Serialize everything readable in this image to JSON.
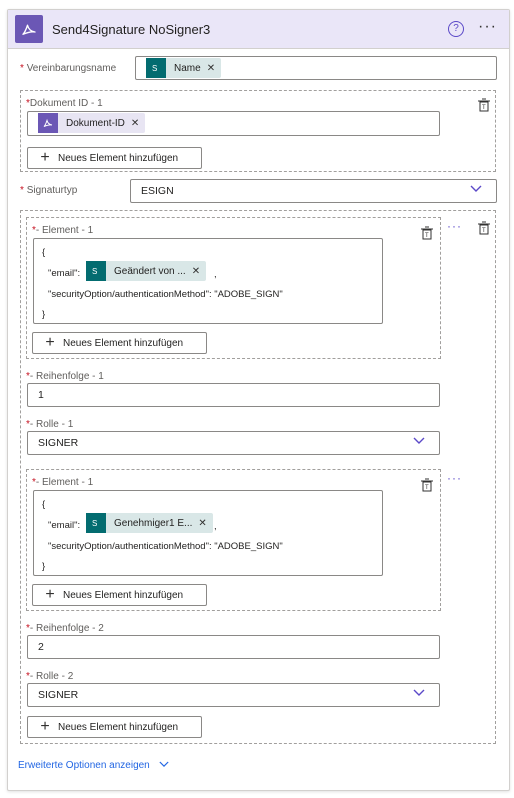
{
  "header": {
    "title": "Send4Signature NoSigner3"
  },
  "fields": {
    "vereinbarungsname": {
      "label": "Vereinbarungsname",
      "token": "Name"
    },
    "dokument": {
      "label": "Dokument ID - 1",
      "token": "Dokument-ID",
      "add_label": "Neues Element hinzufügen"
    },
    "signaturtyp": {
      "label": "Signaturtyp",
      "value": "ESIGN"
    }
  },
  "signers": [
    {
      "element_label": "- Element - 1",
      "json_open": "{",
      "email_key": "\"email\":",
      "email_token": "Geändert von ...",
      "comma": ",",
      "security_line": "\"securityOption/authenticationMethod\": \"ADOBE_SIGN\"",
      "json_close": "}",
      "add_label": "Neues Element hinzufügen",
      "order_label": "- Reihenfolge - 1",
      "order_value": "1",
      "role_label": "- Rolle - 1",
      "role_value": "SIGNER"
    },
    {
      "element_label": "- Element - 1",
      "json_open": "{",
      "email_key": "\"email\":",
      "email_token": "Genehmiger1 E...",
      "comma": ",",
      "security_line": "\"securityOption/authenticationMethod\": \"ADOBE_SIGN\"",
      "json_close": "}",
      "add_label": "Neues Element hinzufügen",
      "order_label": "- Reihenfolge - 2",
      "order_value": "2",
      "role_label": "- Rolle - 2",
      "role_value": "SIGNER"
    }
  ],
  "outer_add_label": "Neues Element hinzufügen",
  "advanced_label": "Erweiterte Optionen anzeigen",
  "required_mark": "*",
  "icons": {
    "app": "adobe-acrobat-icon",
    "token": "sharepoint-icon",
    "help": "help-circle-icon",
    "more": "more-icon",
    "trash": "clear-items-icon",
    "chevron": "chevron-down-icon"
  },
  "colors": {
    "header_bg": "#eae6f8",
    "accent": "#5b49c8",
    "required": "#c50f1f",
    "sharepoint": "#036c70",
    "acrobat": "#6b57b5"
  }
}
